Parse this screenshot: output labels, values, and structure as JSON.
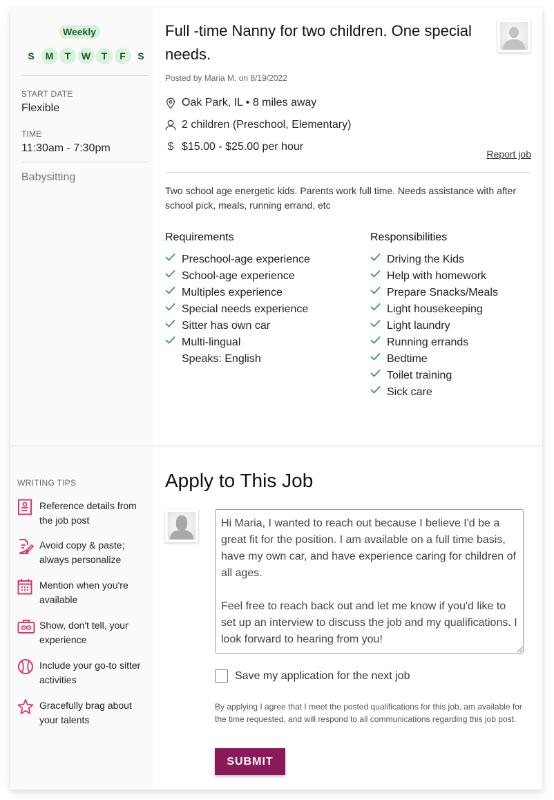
{
  "schedule": {
    "frequency": "Weekly",
    "days": [
      {
        "letter": "S",
        "active": false
      },
      {
        "letter": "M",
        "active": true
      },
      {
        "letter": "T",
        "active": true
      },
      {
        "letter": "W",
        "active": true
      },
      {
        "letter": "T",
        "active": true
      },
      {
        "letter": "F",
        "active": true
      },
      {
        "letter": "S",
        "active": false
      }
    ],
    "start_date_label": "START DATE",
    "start_date_value": "Flexible",
    "time_label": "TIME",
    "time_value": "11:30am - 7:30pm",
    "category": "Babysitting"
  },
  "job": {
    "title": "Full -time Nanny for two children. One special needs.",
    "posted": "Posted by Maria M. on 8/19/2022",
    "location": "Oak Park, IL • 8 miles away",
    "children": "2 children (Preschool, Elementary)",
    "rate": "$15.00 - $25.00 per hour",
    "report_label": "Report job",
    "description": "Two school age energetic kids. Parents work full time. Needs assistance with after school pick, meals, running errand, etc",
    "requirements_heading": "Requirements",
    "requirements": [
      {
        "text": "Preschool-age experience",
        "checked": true
      },
      {
        "text": "School-age experience",
        "checked": true
      },
      {
        "text": "Multiples experience",
        "checked": true
      },
      {
        "text": "Special needs experience",
        "checked": true
      },
      {
        "text": "Sitter has own car",
        "checked": true
      },
      {
        "text": "Multi-lingual",
        "checked": true
      },
      {
        "text": "Speaks: English",
        "checked": false
      }
    ],
    "responsibilities_heading": "Responsibilities",
    "responsibilities": [
      "Driving the Kids",
      "Help with homework",
      "Prepare Snacks/Meals",
      "Light housekeeping",
      "Light laundry",
      "Running errands",
      "Bedtime",
      "Toilet training",
      "Sick care"
    ]
  },
  "tips": {
    "label": "WRITING TIPS",
    "items": [
      {
        "icon": "document-profile-icon",
        "text": "Reference details from the job post"
      },
      {
        "icon": "document-pencil-icon",
        "text": "Avoid copy & paste; always personalize"
      },
      {
        "icon": "calendar-icon",
        "text": "Mention when you're available"
      },
      {
        "icon": "briefcase-heart-icon",
        "text": "Show, don't tell, your experience"
      },
      {
        "icon": "ball-icon",
        "text": "Include your go-to sitter activities"
      },
      {
        "icon": "star-icon",
        "text": "Gracefully brag about your talents"
      }
    ]
  },
  "apply": {
    "title": "Apply to This Job",
    "message": "Hi Maria, I wanted to reach out because I believe I'd be a great fit for the position. I am available on a full time basis, have my own car, and have experience caring for children of all ages.\n\nFeel free to reach back out and let me know if you'd like to set up an interview to discuss the job and my qualifications. I look forward to hearing from you!",
    "save_label": "Save my application for the next job",
    "save_checked": false,
    "legal": "By applying I agree that I meet the posted qualifications for this job, am available for the time requested, and will respond to all communications regarding this job post.",
    "submit_label": "SUBMIT"
  },
  "colors": {
    "accent": "#8c1a5a",
    "tip_icon": "#e0336a",
    "check": "#3a9b55",
    "day_bg": "#d8f2dd",
    "day_text": "#1e5630"
  }
}
